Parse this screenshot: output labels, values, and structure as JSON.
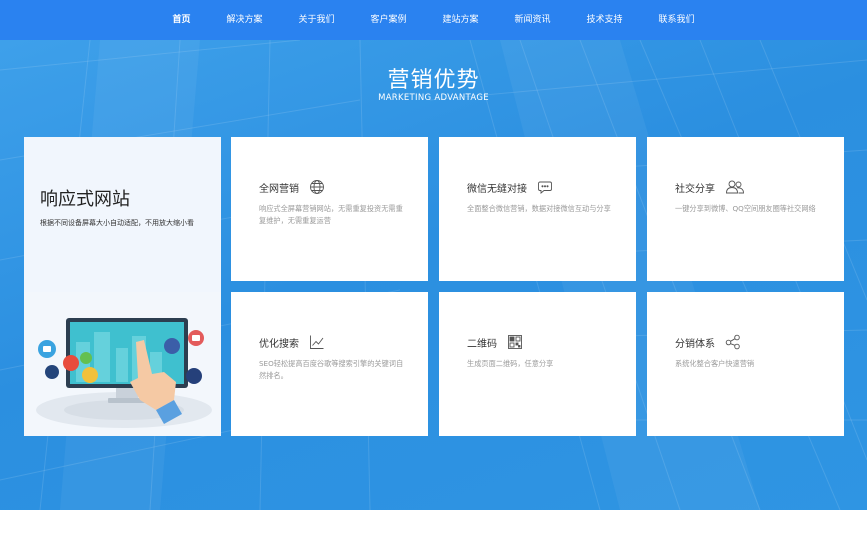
{
  "nav": {
    "items": [
      {
        "label": "首页",
        "active": true
      },
      {
        "label": "解决方案",
        "active": false
      },
      {
        "label": "关于我们",
        "active": false
      },
      {
        "label": "客户案例",
        "active": false
      },
      {
        "label": "建站方案",
        "active": false
      },
      {
        "label": "新闻资讯",
        "active": false
      },
      {
        "label": "技术支持",
        "active": false
      },
      {
        "label": "联系我们",
        "active": false
      }
    ]
  },
  "section": {
    "title": "营销优势",
    "subtitle": "MARKETING ADVANTAGE"
  },
  "feature": {
    "title": "响应式网站",
    "description": "根据不同设备屏幕大小自动适配，不用放大缩小看"
  },
  "cards": [
    {
      "title": "全网营销",
      "icon": "globe-icon",
      "description": "响应式全屏幕营销网站，无需重复投资无需重复维护，无需重复运营"
    },
    {
      "title": "微信无缝对接",
      "icon": "chat-bubble-icon",
      "description": "全面整合微信营销，数据对接微信互动与分享"
    },
    {
      "title": "社交分享",
      "icon": "users-icon",
      "description": "一键分享到微博、QQ空间朋友圈等社交网络"
    },
    {
      "title": "优化搜索",
      "icon": "line-chart-icon",
      "description": "SEO轻松提高百度谷歌等搜索引擎的关键词自然排名。"
    },
    {
      "title": "二维码",
      "icon": "qrcode-icon",
      "description": "生成页面二维码，任意分享"
    },
    {
      "title": "分销体系",
      "icon": "share-nodes-icon",
      "description": "系统化整合客户快速营销"
    }
  ],
  "colors": {
    "nav_bg": "#2a82f0",
    "hero_bg": "#3a9ae6",
    "card_bg": "#ffffff",
    "card_title": "#333333",
    "card_desc": "#9a9a9a"
  }
}
